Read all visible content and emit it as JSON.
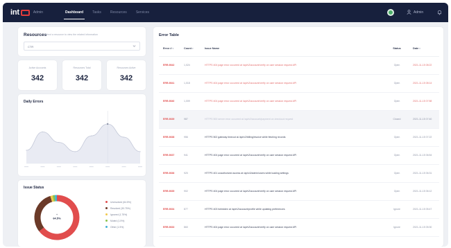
{
  "app": {
    "logo_text": "int",
    "logo_suffix": "ream",
    "logo_sub": "Admin"
  },
  "nav": {
    "items": [
      {
        "label": "Dashboard",
        "active": true
      },
      {
        "label": "Tasks",
        "active": false
      },
      {
        "label": "Resources",
        "active": false
      },
      {
        "label": "Services",
        "active": false
      }
    ]
  },
  "user": {
    "label": "Admin"
  },
  "resources": {
    "title": "Resources",
    "subtitle": "Select a resource to view the related information",
    "selected": "CTR"
  },
  "stats": [
    {
      "label": "Active Accounts",
      "value": "342"
    },
    {
      "label": "Resources Total",
      "value": "342"
    },
    {
      "label": "Resources Active",
      "value": "342"
    }
  ],
  "traffic": {
    "title": "Daily Errors"
  },
  "chart_data": {
    "type": "area",
    "title": "Daily Errors",
    "x": [
      "",
      "",
      "",
      "",
      "",
      "",
      "",
      ""
    ],
    "values": [
      20,
      48,
      32,
      18,
      42,
      60,
      40,
      18
    ],
    "ylim": [
      0,
      80
    ],
    "grid": false
  },
  "donut": {
    "title": "Issue Status",
    "center_label": "64.5%",
    "slices": [
      {
        "label": "Unresolved (64.5%)",
        "value": 64.5,
        "color": "#e14d4d"
      },
      {
        "label": "Resolved (30.75%)",
        "value": 30.75,
        "color": "#6b3a28"
      },
      {
        "label": "Ignored (1.75%)",
        "value": 1.75,
        "color": "#f1c84b"
      },
      {
        "label": "Muted (1.5%)",
        "value": 1.5,
        "color": "#8bc34a"
      },
      {
        "label": "Other (1.5%)",
        "value": 1.5,
        "color": "#42b0d6"
      }
    ]
  },
  "table": {
    "title": "Error Table",
    "headers": [
      "Error #",
      "Count",
      "Issue Name",
      "Status",
      "Date"
    ],
    "rows": [
      {
        "num": "ERR-9842",
        "acc": "1,024",
        "issue": "HTTPS 404 page error occurred at /api/v2/account/verify on user session request API",
        "status": "Open",
        "date": "2021-11-15 08:22",
        "style": "red"
      },
      {
        "num": "ERR-9841",
        "acc": "1,018",
        "issue": "HTTPS 404 page error occurred at /api/v2/account/verify on user session request API",
        "status": "Open",
        "date": "2021-11-15 08:14",
        "style": "red"
      },
      {
        "num": "ERR-9840",
        "acc": "1,009",
        "issue": "HTTPS 404 page error occurred at /api/v2/account/verify on user session request API",
        "status": "Open",
        "date": "2021-11-15 07:58",
        "style": "red"
      },
      {
        "num": "ERR-9839",
        "acc": "987",
        "issue": "HTTPS 500 server error occurred at /api/v2/account/payment on checkout request",
        "status": "Closed",
        "date": "2021-11-15 07:40",
        "style": "muted"
      },
      {
        "num": "ERR-9838",
        "acc": "956",
        "issue": "HTTPS 502 gateway timeout at /api/v2/billing/invoice while fetching records",
        "status": "Open",
        "date": "2021-11-15 07:22",
        "style": "dark"
      },
      {
        "num": "ERR-9837",
        "acc": "941",
        "issue": "HTTPS 404 page error occurred at /api/v2/account/verify on user session request API",
        "status": "Open",
        "date": "2021-11-15 06:54",
        "style": "dark"
      },
      {
        "num": "ERR-9836",
        "acc": "920",
        "issue": "HTTPS 401 unauthorized access at /api/v2/admin/users while loading settings",
        "status": "Open",
        "date": "2021-11-15 06:31",
        "style": "dark"
      },
      {
        "num": "ERR-9835",
        "acc": "902",
        "issue": "HTTPS 404 page error occurred at /api/v2/account/verify on user session request API",
        "status": "Open",
        "date": "2021-11-15 06:12",
        "style": "dark"
      },
      {
        "num": "ERR-9834",
        "acc": "877",
        "issue": "HTTPS 403 forbidden at /api/v2/account/profile while updating preferences",
        "status": "Ignore",
        "date": "2021-11-15 05:47",
        "style": "dark"
      },
      {
        "num": "ERR-9833",
        "acc": "860",
        "issue": "HTTPS 404 page error occurred at /api/v2/account/verify on user session request API",
        "status": "Ignore",
        "date": "2021-11-15 05:30",
        "style": "dark"
      }
    ]
  }
}
